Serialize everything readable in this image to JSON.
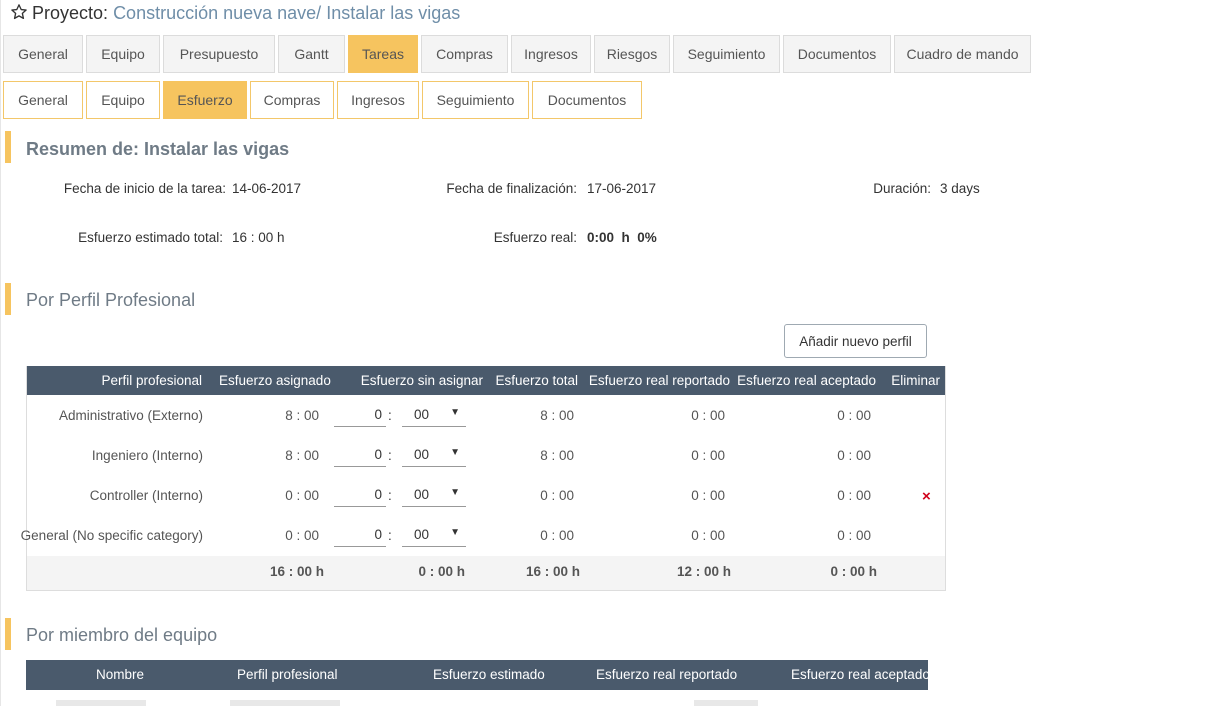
{
  "project": {
    "prefix": "Proyecto:",
    "name": "Construcción nueva nave/ Instalar las vigas"
  },
  "main_tabs": [
    "General",
    "Equipo",
    "Presupuesto",
    "Gantt",
    "Tareas",
    "Compras",
    "Ingresos",
    "Riesgos",
    "Seguimiento",
    "Documentos",
    "Cuadro de mando"
  ],
  "main_active": "Tareas",
  "sub_tabs": [
    "General",
    "Equipo",
    "Esfuerzo",
    "Compras",
    "Ingresos",
    "Seguimiento",
    "Documentos"
  ],
  "sub_active": "Esfuerzo",
  "summary": {
    "title": "Resumen de: Instalar las vigas",
    "start_label": "Fecha de inicio de la tarea:",
    "start_value": "14-06-2017",
    "end_label": "Fecha de finalización:",
    "end_value": "17-06-2017",
    "duration_label": "Duración:",
    "duration_value": "3 days",
    "estimated_label": "Esfuerzo estimado total:",
    "estimated_value": "16 : 00 h",
    "real_label": "Esfuerzo real:",
    "real_value": "0:00  h  0%"
  },
  "profile_section": {
    "title": "Por Perfil Profesional",
    "add_button": "Añadir nuevo perfil",
    "headers": [
      "Perfil profesional",
      "Esfuerzo asignado",
      "Esfuerzo sin asignar",
      "Esfuerzo total",
      "Esfuerzo real reportado",
      "Esfuerzo real aceptado",
      "Eliminar"
    ],
    "rows": [
      {
        "profile": "Administrativo (Externo)",
        "assigned": "8 : 00",
        "hours": "0",
        "minutes": "00",
        "total": "8 : 00",
        "reported": "0 : 00",
        "accepted": "0 : 00",
        "delete": ""
      },
      {
        "profile": "Ingeniero (Interno)",
        "assigned": "8 : 00",
        "hours": "0",
        "minutes": "00",
        "total": "8 : 00",
        "reported": "0 : 00",
        "accepted": "0 : 00",
        "delete": ""
      },
      {
        "profile": "Controller (Interno)",
        "assigned": "0 : 00",
        "hours": "0",
        "minutes": "00",
        "total": "0 : 00",
        "reported": "0 : 00",
        "accepted": "0 : 00",
        "delete": "×"
      },
      {
        "profile": "General (No specific category)",
        "assigned": "0 : 00",
        "hours": "0",
        "minutes": "00",
        "total": "0 : 00",
        "reported": "0 : 00",
        "accepted": "0 : 00",
        "delete": ""
      }
    ],
    "footer": {
      "assigned": "16 : 00 h",
      "unassigned": "0 : 00 h",
      "total": "16 : 00 h",
      "reported": "12 : 00 h",
      "accepted": "0 : 00 h"
    }
  },
  "member_section": {
    "title": "Por miembro del equipo",
    "headers": [
      "Nombre",
      "Perfil profesional",
      "Esfuerzo estimado",
      "Esfuerzo real reportado",
      "Esfuerzo real aceptado"
    ]
  },
  "colors": {
    "accent": "#f6c45f",
    "header_bg": "#4a5a6c",
    "link": "#6f8ea8",
    "delete": "#d0021b"
  },
  "icons": {
    "star": "star-outline-icon",
    "select_arrow": "caret-down-icon",
    "delete": "close-icon"
  }
}
